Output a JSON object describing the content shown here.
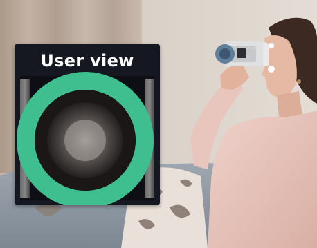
{
  "inset": {
    "title": "User view",
    "ring_color": "#3fbf8f"
  },
  "palette": {
    "wall": "#d6cdc4",
    "curtain": "#b9a89b",
    "sofa": "#8e98a3",
    "shirt": "#e7c5bd",
    "hair": "#3c2a22",
    "skin": "#e6b9a4",
    "device_body": "#dfe0e2",
    "device_lens": "#5f7f9a"
  }
}
